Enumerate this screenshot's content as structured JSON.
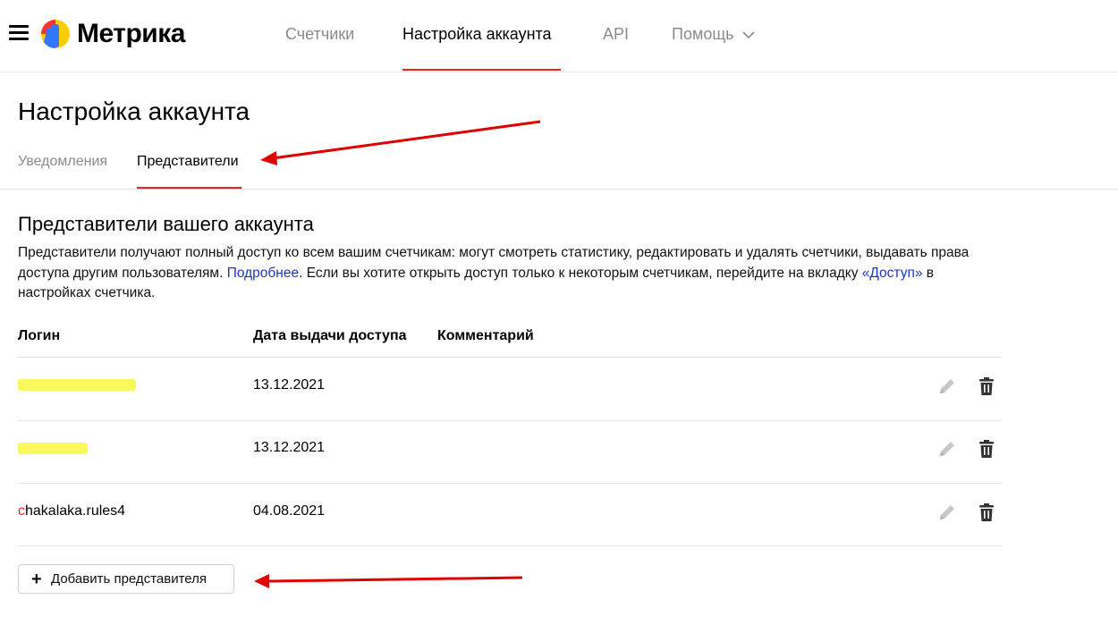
{
  "header": {
    "brand": "Метрика",
    "nav": [
      {
        "label": "Счетчики"
      },
      {
        "label": "Настройка аккаунта"
      },
      {
        "label": "API"
      },
      {
        "label": "Помощь"
      }
    ]
  },
  "page": {
    "title": "Настройка аккаунта",
    "subtabs": [
      {
        "label": "Уведомления"
      },
      {
        "label": "Представители"
      }
    ]
  },
  "section": {
    "title": "Представители вашего аккаунта",
    "desc_1": "Представители получают полный доступ ко всем вашим счетчикам: могут смотреть статистику, редактировать и удалять счетчики, выдавать права доступа другим пользователям. ",
    "desc_link_1": "Подробнее",
    "desc_2": ". Если вы хотите открыть доступ только к некоторым счетчикам, перейдите на вкладку ",
    "desc_link_2": "«Доступ»",
    "desc_3": " в настройках счетчика."
  },
  "table": {
    "headers": [
      "Логин",
      "Дата выдачи доступа",
      "Комментарий"
    ],
    "rows": [
      {
        "login": "",
        "date": "13.12.2021",
        "comment": ""
      },
      {
        "login": "",
        "date": "13.12.2021",
        "comment": ""
      },
      {
        "login_first": "c",
        "login_rest": "hakalaka.rules4",
        "date": "04.08.2021",
        "comment": ""
      }
    ]
  },
  "actions": {
    "add_button": "Добавить представителя"
  },
  "colors": {
    "accent": "#e52620",
    "link": "#1a36c8",
    "redaction": "#f8f74a"
  },
  "icons": [
    "menu-icon",
    "metrika-logo",
    "chevron-down-icon",
    "pencil-icon",
    "trash-icon",
    "plus-icon",
    "red-arrow-annotation"
  ]
}
